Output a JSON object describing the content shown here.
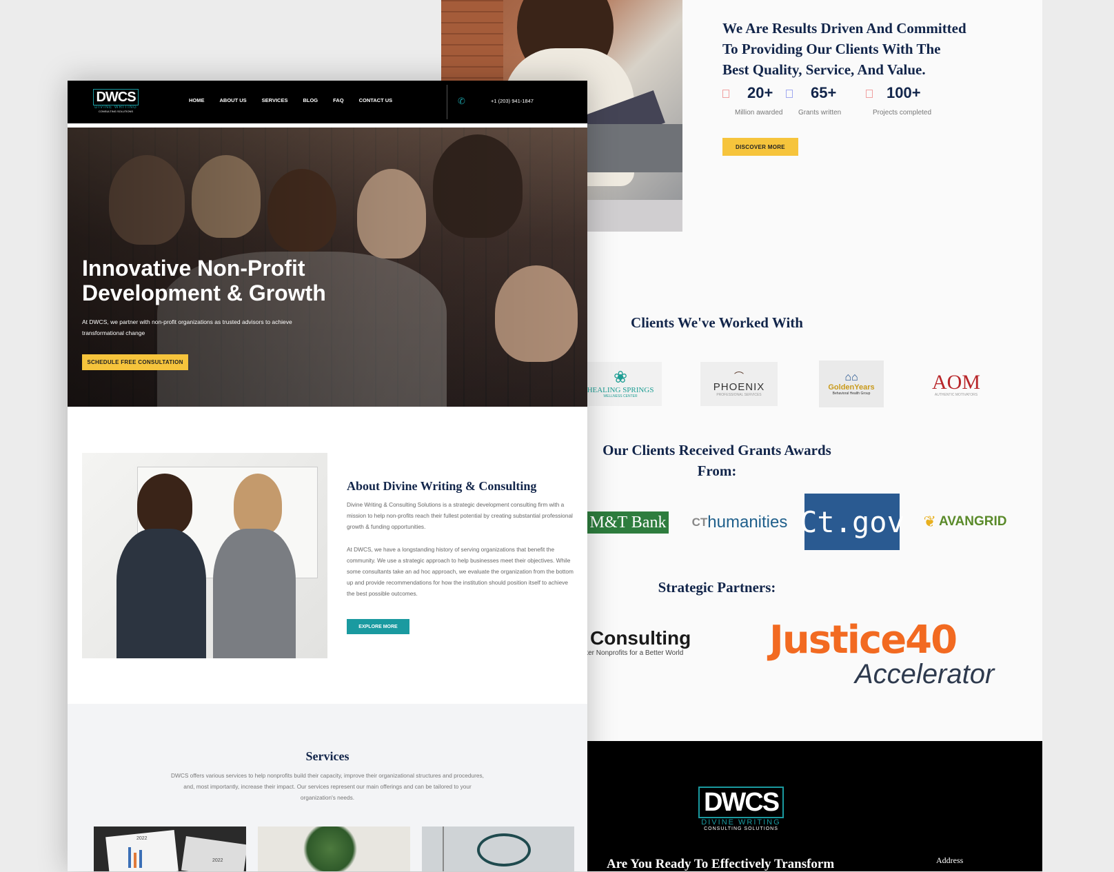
{
  "nav": {
    "logo_text": "DWCS",
    "logo_sub1": "DIVINE WRITING",
    "logo_sub2": "CONSULTING SOLUTIONS",
    "items": [
      "HOME",
      "ABOUT US",
      "SERVICES",
      "BLOG",
      "FAQ",
      "CONTACT US"
    ],
    "phone": "+1 (203) 941-1847",
    "phone_icon": "phone-icon"
  },
  "hero": {
    "title_line1": "Innovative Non-Profit",
    "title_line2": "Development & Growth",
    "subtitle": "At DWCS, we partner with non-profit organizations as trusted advisors to achieve transformational change",
    "cta": "SCHEDULE FREE CONSULTATION"
  },
  "about": {
    "title": "About Divine Writing & Consulting",
    "para1": "Divine Writing & Consulting Solutions is a strategic development consulting firm with a mission to help non-profits reach their fullest potential by creating substantial professional growth & funding opportunities.",
    "para2": "At DWCS, we have a longstanding history of serving organizations that benefit the community. We use a strategic approach to help businesses meet their objectives. While some consultants take an ad hoc approach, we evaluate the organization from the bottom up and provide recommendations for how the institution should position itself to achieve the best possible outcomes.",
    "cta": "EXPLORE MORE"
  },
  "services": {
    "title": "Services",
    "desc": "DWCS offers various services to help nonprofits build their capacity, improve their organizational structures and procedures, and, most importantly, increase their impact. Our services represent our main offerings and can be tailored to your organization's needs.",
    "card1_text1": "2022",
    "card1_text2": "2022"
  },
  "results": {
    "title_line1": "We Are Results Driven And Committed",
    "title_line2": "To Providing Our Clients With The",
    "title_line3": "Best Quality, Service, And Value.",
    "stats": [
      {
        "value": "20+",
        "label": "Million awarded"
      },
      {
        "value": "65+",
        "label": "Grants written"
      },
      {
        "value": "100+",
        "label": "Projects completed"
      }
    ],
    "cta": "DISCOVER MORE"
  },
  "clients": {
    "title": "Clients We've Worked With",
    "logos": {
      "healing": "HEALING SPRINGS",
      "healing_sub": "WELLNESS CENTER",
      "phoenix": "PHOENIX",
      "phoenix_sub": "PROFESSIONAL SERVICES",
      "golden": "GoldenYears",
      "golden_sub": "Behavioral Health Group",
      "aom": "AOM",
      "aom_sub": "AUTHENTIC MOTIVATORS"
    }
  },
  "grants": {
    "title_line1": "Our Clients Received Grants Awards",
    "title_line2": "From:",
    "mt": "M&T Bank",
    "ct_prefix": "CT",
    "ct_main": "humanities",
    "ctgov": "Ct.gov",
    "avangrid": "AVANGRID"
  },
  "partners": {
    "title": "Strategic Partners:",
    "consulting": "Consulting",
    "consulting_sub": "etter Nonprofits for a Better World",
    "justice": "Justice40",
    "accelerator": "Accelerator"
  },
  "footer": {
    "logo_text": "DWCS",
    "logo_sub1": "DIVINE WRITING",
    "logo_sub2": "CONSULTING SOLUTIONS",
    "heading": "Are You Ready To Effectively Transform",
    "address_label": "Address"
  },
  "colors": {
    "navy": "#12254a",
    "yellow": "#f6c43c",
    "teal": "#1a9aa0",
    "orange": "#f26a21"
  }
}
